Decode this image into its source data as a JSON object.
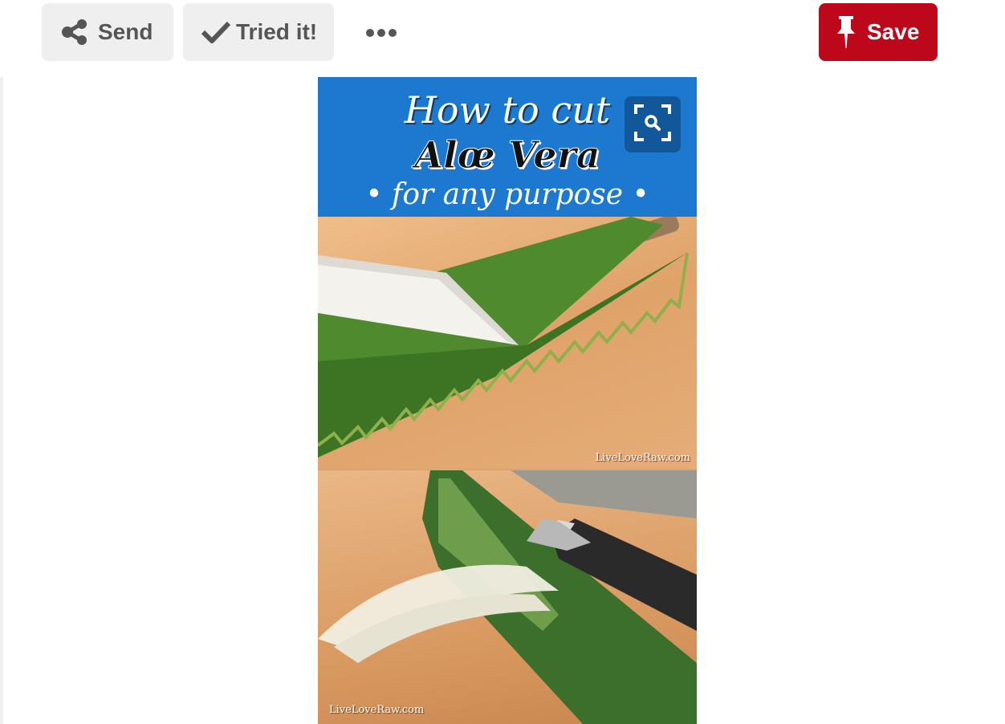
{
  "toolbar": {
    "send_label": "Send",
    "tried_label": "Tried it!",
    "more_label": "•••",
    "save_label": "Save",
    "save_color": "#bd081c",
    "secondary_color": "#efefef"
  },
  "icons": {
    "send": "share-icon",
    "tried": "checkmark-icon",
    "save": "pushpin-icon",
    "zoom": "visual-search-icon"
  },
  "pin_image": {
    "banner_line1": "How to cut",
    "banner_line2": "Alœ Vera",
    "banner_line3": "• for any purpose •",
    "banner_color": "#1c79cf",
    "watermark_top": "LiveLoveRaw.com",
    "watermark_bottom": "LiveLoveRaw.com"
  }
}
